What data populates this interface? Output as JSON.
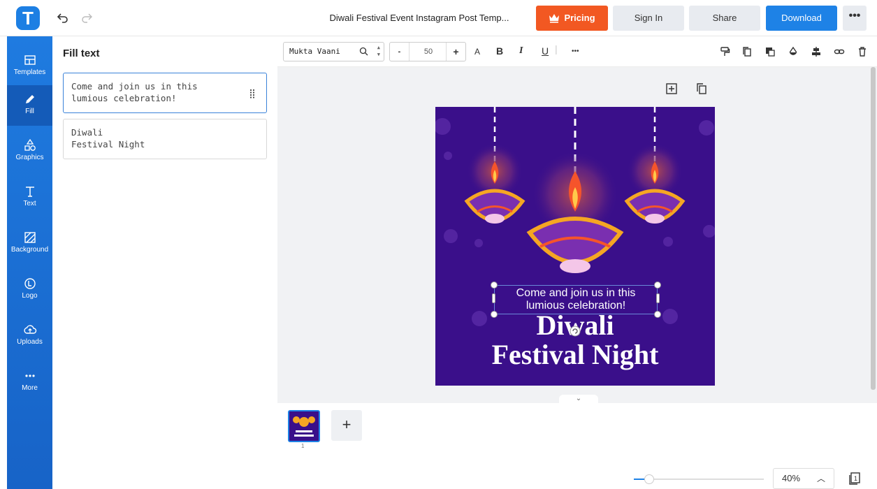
{
  "app": {
    "logo_letter": "T",
    "doc_title": "Diwali Festival Event Instagram Post Temp..."
  },
  "topbar": {
    "pricing_label": "Pricing",
    "signin_label": "Sign In",
    "share_label": "Share",
    "download_label": "Download",
    "more_label": "•••"
  },
  "sidebar": {
    "items": [
      {
        "label": "Templates",
        "icon": "templates-icon"
      },
      {
        "label": "Fill",
        "icon": "pen-icon"
      },
      {
        "label": "Graphics",
        "icon": "shapes-icon"
      },
      {
        "label": "Text",
        "icon": "text-icon"
      },
      {
        "label": "Background",
        "icon": "background-icon"
      },
      {
        "label": "Logo",
        "icon": "logo-icon"
      },
      {
        "label": "Uploads",
        "icon": "cloud-upload-icon"
      },
      {
        "label": "More",
        "icon": "more-icon"
      }
    ],
    "active": "Fill"
  },
  "panel": {
    "title": "Fill text",
    "fields": [
      {
        "value": "Come and join us in this lumious celebration!",
        "active": true
      },
      {
        "value": "Diwali\nFestival Night",
        "active": false
      }
    ]
  },
  "toolbar": {
    "font_name": "Mukta Vaani",
    "font_size": "50",
    "minus": "-",
    "plus": "+",
    "caps": "A",
    "bold": "B",
    "italic": "I",
    "underline": "U",
    "more": "•••"
  },
  "canvas": {
    "selected_text_line1": "Come and join us in this",
    "selected_text_line2": "lumious celebration!",
    "title_line1": "Diwali",
    "title_line2": "Festival Night",
    "background_color": "#3a0f8a"
  },
  "pages": {
    "current": "1",
    "add_label": "+"
  },
  "zoom": {
    "level": "40%",
    "slider_fraction": 0.12
  }
}
